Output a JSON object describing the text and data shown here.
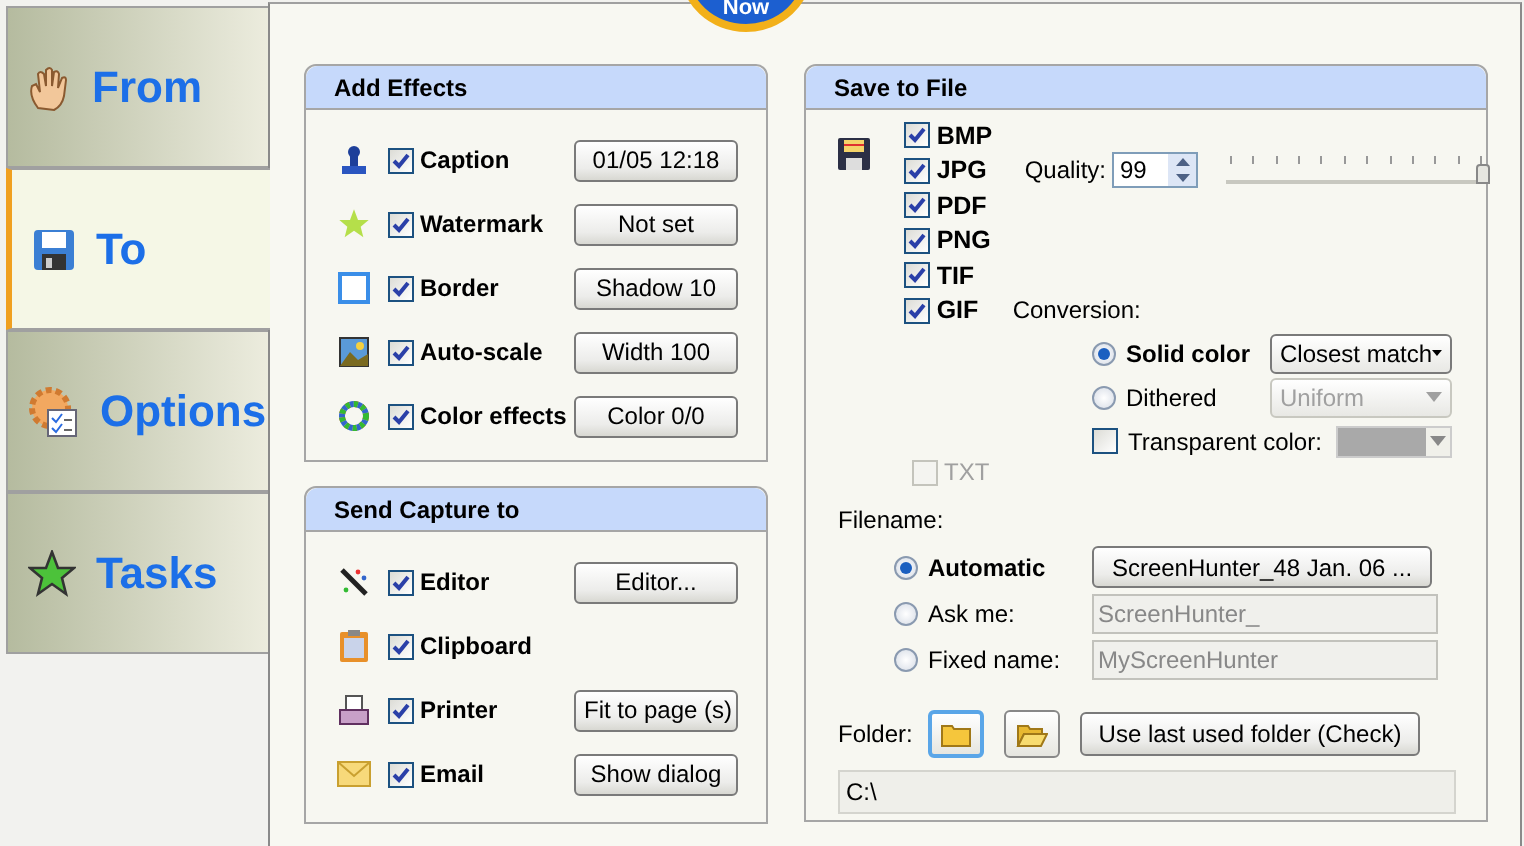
{
  "badge": {
    "label": "Now"
  },
  "tabs": [
    {
      "label": "From",
      "selected": false
    },
    {
      "label": "To",
      "selected": true
    },
    {
      "label": "Options",
      "selected": false
    },
    {
      "label": "Tasks",
      "selected": false
    }
  ],
  "add_effects": {
    "title": "Add Effects",
    "items": [
      {
        "label": "Caption",
        "checked": true,
        "button": "01/05  12:18"
      },
      {
        "label": "Watermark",
        "checked": true,
        "button": "Not set"
      },
      {
        "label": "Border",
        "checked": true,
        "button": "Shadow 10"
      },
      {
        "label": "Auto-scale",
        "checked": true,
        "button": "Width 100"
      },
      {
        "label": "Color effects",
        "checked": true,
        "button": "Color 0/0"
      }
    ]
  },
  "send_capture": {
    "title": "Send Capture to",
    "items": [
      {
        "label": "Editor",
        "checked": true,
        "button": "Editor..."
      },
      {
        "label": "Clipboard",
        "checked": true
      },
      {
        "label": "Printer",
        "checked": true,
        "button": "Fit to page (s)"
      },
      {
        "label": "Email",
        "checked": true,
        "button": "Show dialog"
      }
    ]
  },
  "save_to_file": {
    "title": "Save to File",
    "formats": [
      {
        "label": "BMP",
        "checked": true
      },
      {
        "label": "JPG",
        "checked": true,
        "quality": {
          "label": "Quality:",
          "value": "99",
          "level": 0.99
        }
      },
      {
        "label": "PDF",
        "checked": true
      },
      {
        "label": "PNG",
        "checked": true
      },
      {
        "label": "TIF",
        "checked": true
      },
      {
        "label": "GIF",
        "checked": true,
        "note": "Conversion:"
      }
    ],
    "conversion": {
      "options": [
        {
          "label": "Solid color",
          "selected": true,
          "dropdown": "Closest match",
          "disabled": false
        },
        {
          "label": "Dithered",
          "selected": false,
          "dropdown": "Uniform",
          "disabled": true
        }
      ],
      "transparent": {
        "label": "Transparent color:",
        "checked": false
      }
    },
    "txt": {
      "label": "TXT",
      "checked": false,
      "disabled": true
    },
    "filename": {
      "label": "Filename:",
      "options": [
        {
          "label": "Automatic",
          "selected": true,
          "kind": "button",
          "value": "ScreenHunter_48 Jan. 06 ..."
        },
        {
          "label": "Ask me:",
          "selected": false,
          "kind": "field",
          "value": "ScreenHunter_"
        },
        {
          "label": "Fixed name:",
          "selected": false,
          "kind": "field",
          "value": "MyScreenHunter"
        }
      ]
    },
    "folder": {
      "label": "Folder:",
      "button": "Use last used folder (Check)",
      "path": "C:\\"
    }
  }
}
